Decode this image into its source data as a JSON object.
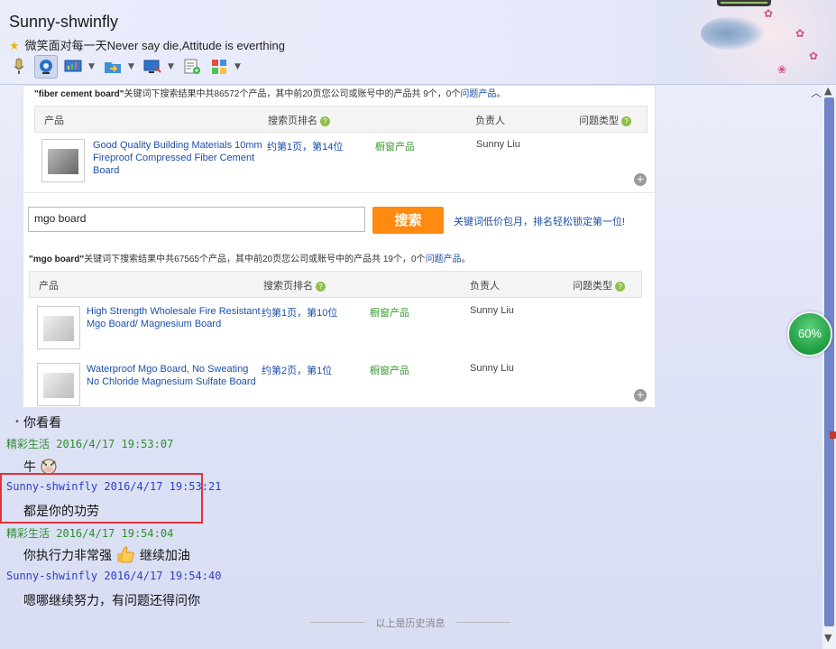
{
  "window": {
    "title": "Sunny-shwinfly",
    "signature": "微笑面对每一天Never say die,Attitude is everthing"
  },
  "toolbar": {
    "icons": [
      "microphone-icon",
      "webcam-icon",
      "screen-share-icon",
      "file-transfer-icon",
      "remote-desktop-icon",
      "new-chat-icon",
      "apps-icon"
    ]
  },
  "shot": {
    "kw1": {
      "keyword": "\"fiber cement board\"",
      "text_a": "关键词下搜索结果中共86572个产品，其中前20页您公司或账号中的产品共 9个，",
      "count": "0个",
      "link": "问题产品",
      "end": "。"
    },
    "table_headers": {
      "product": "产品",
      "rank": "搜索页排名",
      "owner": "负责人",
      "issue": "问题类型"
    },
    "row1": {
      "title": "Good Quality Building Materials 10mm Fireproof Compressed Fiber Cement Board",
      "rank": "约第1页，第14位",
      "type": "橱窗产品",
      "owner": "Sunny Liu"
    },
    "search": {
      "value": "mgo board",
      "button": "搜索",
      "promo": "关键词低价包月，排名轻松锁定第一位!"
    },
    "kw2": {
      "keyword": "\"mgo board\"",
      "text_a": "关键词下搜索结果中共67565个产品，其中前20页您公司或账号中的产品共 19个，",
      "count": "0个",
      "link": "问题产品",
      "end": "。"
    },
    "row2": {
      "title": "High Strength Wholesale Fire Resistant Mgo Board/ Magnesium Board",
      "rank": "约第1页，第10位",
      "type": "橱窗产品",
      "owner": "Sunny Liu"
    },
    "row3": {
      "title": "Waterproof Mgo Board, No Sweating No Chloride Magnesium Sulfate Board",
      "rank": "约第2页，第1位",
      "type": "橱窗产品",
      "owner": "Sunny Liu"
    }
  },
  "messages": [
    {
      "sender": "",
      "time": "",
      "text": "你看看"
    },
    {
      "sender": "精彩生活",
      "time": "2016/4/17 19:53:07",
      "text": "牛"
    },
    {
      "sender": "Sunny-shwinfly",
      "time": "2016/4/17 19:53:21",
      "text": "都是你的功劳"
    },
    {
      "sender": "精彩生活",
      "time": "2016/4/17 19:54:04",
      "text": "你执行力非常强",
      "text2": "继续加油"
    },
    {
      "sender": "Sunny-shwinfly",
      "time": "2016/4/17 19:54:40",
      "text": "嗯哪继续努力，有问题还得问你"
    }
  ],
  "history_divider": "以上是历史消息",
  "gauge": {
    "label": "60%"
  },
  "colors": {
    "accent_red": "#e0343c",
    "search_orange": "#ff8a10",
    "sender_green": "#2d8f2d",
    "sender_blue": "#2a3fc9"
  }
}
